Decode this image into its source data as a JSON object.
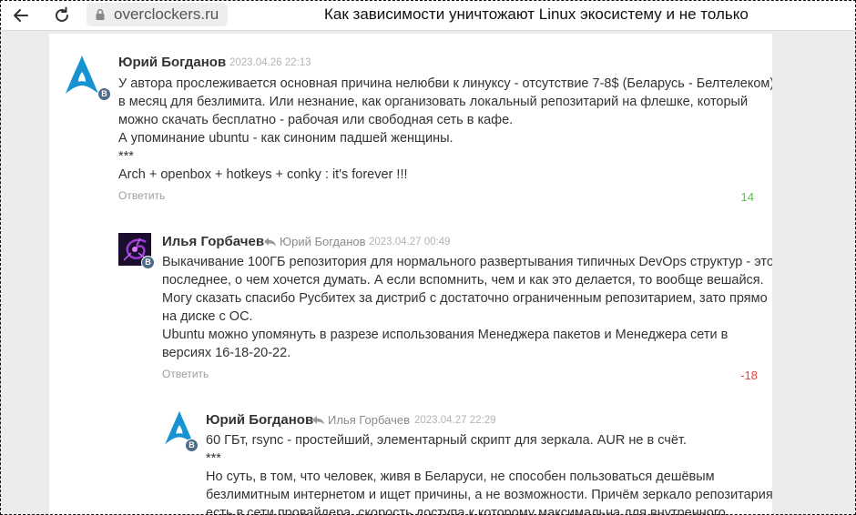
{
  "browser": {
    "url": "overclockers.ru",
    "page_title": "Как зависимости уничтожают Linux экосистему и не только"
  },
  "comments": [
    {
      "author": "Юрий Богданов",
      "reply_to": "",
      "date": "2023.04.26 22:13",
      "badge": "B",
      "lines": [
        "У автора прослеживается основная причина нелюбви к линуксу - отсутствие 7-8$ (Беларусь - Белтелеком)",
        "в месяц для безлимита. Или незнание, как организовать локальный репозитарий на флешке, который",
        "можно скачать бесплатно - рабочая или свободная сеть в кафе.",
        "А упоминание ubuntu - как синоним падшей женщины.",
        "***",
        "Arch + openbox + hotkeys + conky : it's forever !!!"
      ],
      "reply_label": "Ответить",
      "rating": "14"
    },
    {
      "author": "Илья Горбачев",
      "reply_to": "Юрий Богданов",
      "date": "2023.04.27 00:49",
      "badge": "B",
      "lines": [
        "Выкачивание 100ГБ репозитория для нормального развертывания типичных DevOps структур - это",
        "последнее, о чем хочется думать. А если вспомнить, чем и как это делается, то вообще вешайся.",
        "Могу сказать спасибо Русбитех за дистриб с достаточно ограниченным репозитарием, зато прямо",
        "на диске с ОС.",
        "Ubuntu можно упомянуть в разрезе использования Менеджера пакетов и Менеджера сети в",
        "версиях 16-18-20-22."
      ],
      "reply_label": "Ответить",
      "rating": "-18"
    },
    {
      "author": "Юрий Богданов",
      "reply_to": "Илья Горбачев",
      "date": "2023.04.27 22:29",
      "badge": "B",
      "lines": [
        "60 ГБт, rsync - простейший, элементарный скрипт для зеркала. AUR не в счёт.",
        "***",
        "Но суть, в том, что человек, живя в Беларуси, не способен пользоваться дешёвым",
        "безлимитным интернетом и ищет причины, а не возможности. Причём зеркало репозитария",
        "есть в сети провайдера, скорость доступа к которому максимальна для внутренного"
      ]
    }
  ],
  "colors": {
    "positive": "#4cd137",
    "negative": "#e84141",
    "badge": "#4e6c8a",
    "arch_blue": "#1793d1"
  }
}
